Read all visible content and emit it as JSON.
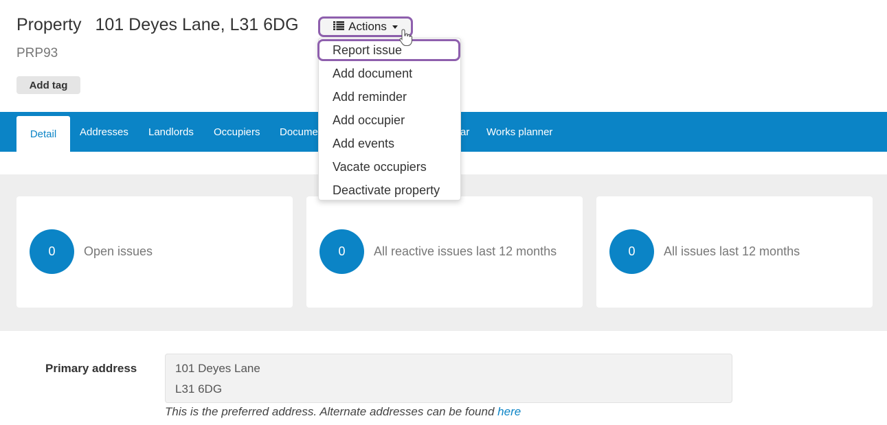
{
  "header": {
    "entity_label": "Property",
    "address": "101 Deyes Lane, L31 6DG",
    "code": "PRP93",
    "add_tag_label": "Add tag",
    "actions_label": "Actions"
  },
  "actions_menu": {
    "items": [
      {
        "label": "Report issue",
        "highlighted": true
      },
      {
        "label": "Add document"
      },
      {
        "label": "Add reminder"
      },
      {
        "label": "Add occupier"
      },
      {
        "label": "Add events"
      },
      {
        "label": "Vacate occupiers"
      },
      {
        "label": "Deactivate property"
      }
    ]
  },
  "tabs": [
    {
      "label": "Detail",
      "active": true
    },
    {
      "label": "Addresses"
    },
    {
      "label": "Landlords"
    },
    {
      "label": "Occupiers"
    },
    {
      "label": "Docume"
    },
    {
      "label": "ar"
    },
    {
      "label": "Works planner"
    }
  ],
  "stats": [
    {
      "value": "0",
      "label": "Open issues"
    },
    {
      "value": "0",
      "label": "All reactive issues last 12 months"
    },
    {
      "value": "0",
      "label": "All issues last 12 months"
    }
  ],
  "primary_address": {
    "label": "Primary address",
    "line1": "101 Deyes Lane",
    "line2": "L31 6DG",
    "note": "This is the preferred address. Alternate addresses can be found ",
    "link_text": "here"
  },
  "colors": {
    "brand_blue": "#0b84c6",
    "highlight_purple": "#8e5fad"
  },
  "icons": {
    "actions": "list-icon",
    "caret": "caret-down-icon",
    "pointer": "hand-pointer-icon"
  }
}
